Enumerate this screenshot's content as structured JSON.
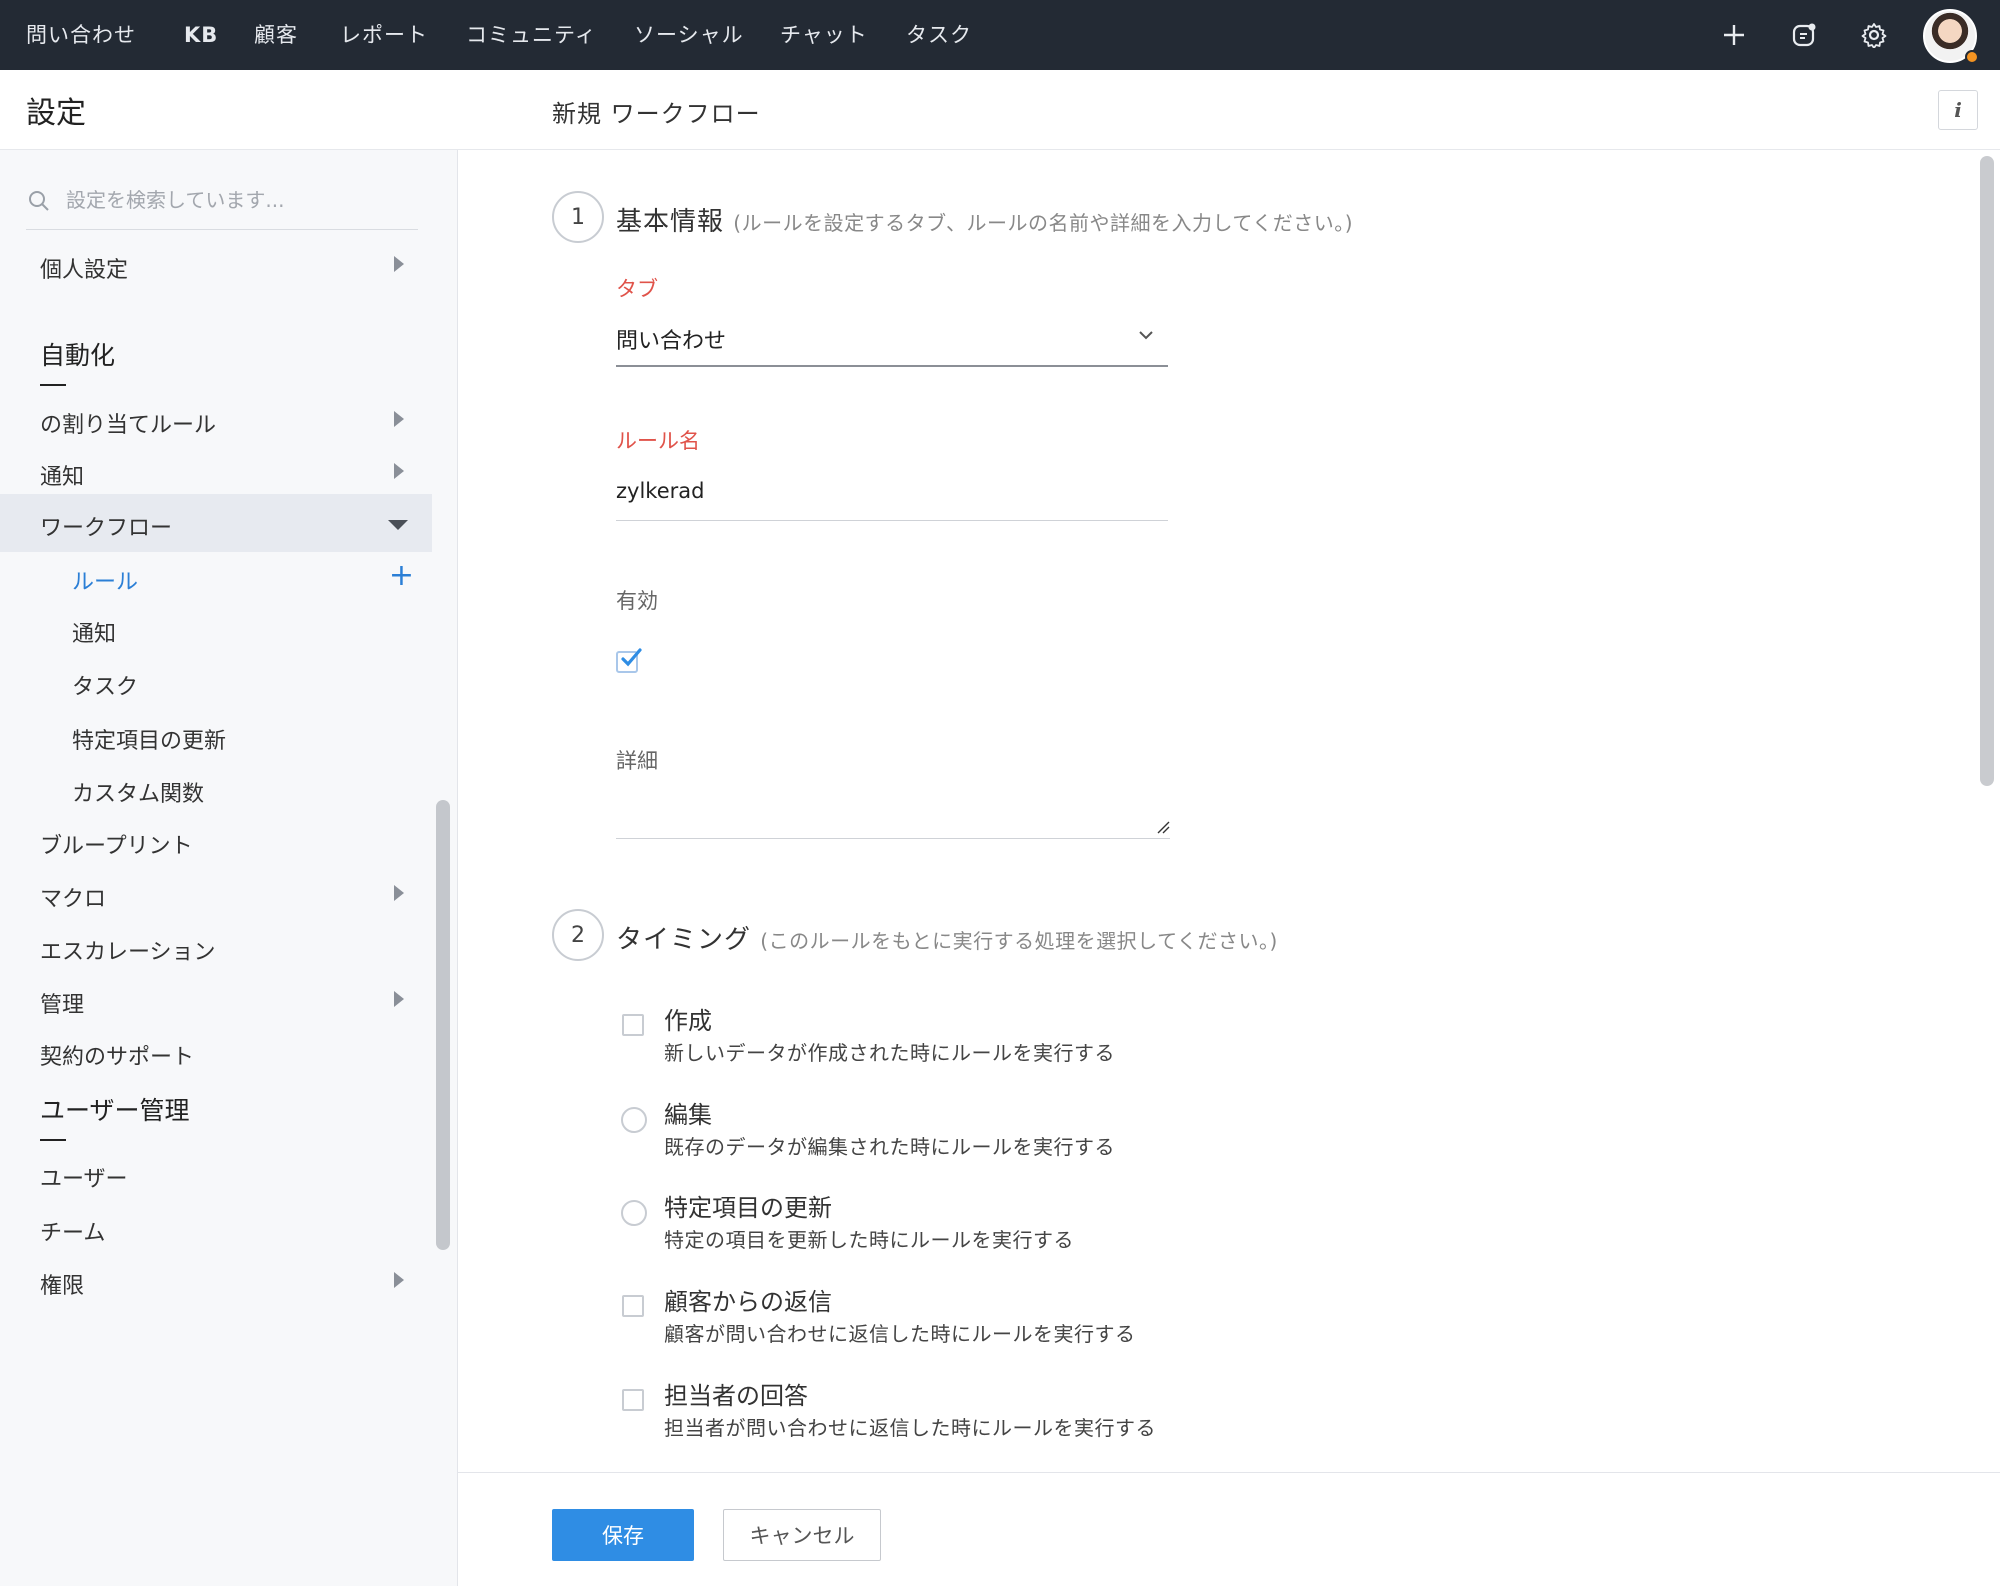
{
  "topnav": {
    "items": [
      "問い合わせ",
      "KB",
      "顧客",
      "レポート",
      "コミュニティ",
      "ソーシャル",
      "チャット",
      "タスク"
    ],
    "icons": [
      "plus-icon",
      "feedback-icon",
      "gear-icon"
    ]
  },
  "sidebar": {
    "title": "設定",
    "search_placeholder": "設定を検索しています...",
    "items": [
      {
        "label": "個人設定"
      },
      {
        "label": "自動化"
      },
      {
        "label": "の割り当てルール"
      },
      {
        "label": "通知"
      },
      {
        "label": "ワークフロー"
      },
      {
        "label": "ルール"
      },
      {
        "label": "通知"
      },
      {
        "label": "タスク"
      },
      {
        "label": "特定項目の更新"
      },
      {
        "label": "カスタム関数"
      },
      {
        "label": "ブループリント"
      },
      {
        "label": "マクロ"
      },
      {
        "label": "エスカレーション"
      },
      {
        "label": "管理"
      },
      {
        "label": "契約のサポート"
      },
      {
        "label": "ユーザー管理"
      },
      {
        "label": "ユーザー"
      },
      {
        "label": "チーム"
      },
      {
        "label": "権限"
      }
    ]
  },
  "main": {
    "title": "新規 ワークフロー",
    "info_label": "i",
    "step1": {
      "number": "1",
      "title": "基本情報",
      "hint": "(ルールを設定するタブ、ルールの名前や詳細を入力してください。)",
      "tab_label": "タブ",
      "tab_value": "問い合わせ",
      "rule_name_label": "ルール名",
      "rule_name_value": "zylkerad",
      "active_label": "有効",
      "active_checked": true,
      "detail_label": "詳細"
    },
    "step2": {
      "number": "2",
      "title": "タイミング",
      "hint": "(このルールをもとに実行する処理を選択してください。)",
      "options": [
        {
          "title": "作成",
          "desc": "新しいデータが作成された時にルールを実行する",
          "control": "checkbox"
        },
        {
          "title": "編集",
          "desc": "既存のデータが編集された時にルールを実行する",
          "control": "radio"
        },
        {
          "title": "特定項目の更新",
          "desc": "特定の項目を更新した時にルールを実行する",
          "control": "radio"
        },
        {
          "title": "顧客からの返信",
          "desc": "顧客が問い合わせに返信した時にルールを実行する",
          "control": "checkbox"
        },
        {
          "title": "担当者の回答",
          "desc": "担当者が問い合わせに返信した時にルールを実行する",
          "control": "checkbox"
        }
      ]
    }
  },
  "footer": {
    "save_label": "保存",
    "cancel_label": "キャンセル"
  },
  "colors": {
    "topbar": "#232a34",
    "accent": "#2f8de4",
    "required": "#e0534a",
    "selected_row": "#e7eaf0"
  }
}
